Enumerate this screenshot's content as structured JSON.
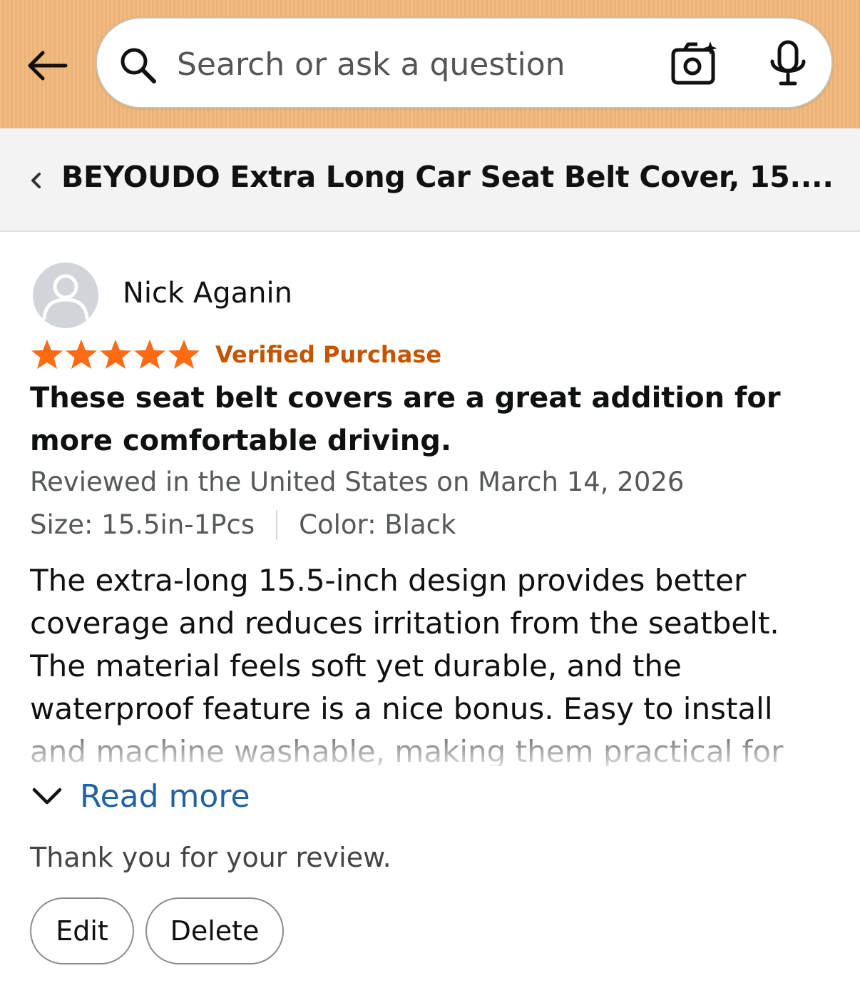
{
  "header": {
    "search": {
      "placeholder": "Search or ask a question"
    },
    "icons": {
      "back": "arrow-left-icon",
      "search": "search-icon",
      "camera": "camera-sparkle-icon",
      "mic": "microphone-icon"
    },
    "background_color": "#f0b679"
  },
  "product": {
    "title": "BEYOUDO Extra Long Car Seat Belt Cover, 15...."
  },
  "review": {
    "reviewer_name": "Nick Aganin",
    "rating": 5,
    "rating_max": 5,
    "star_color": "#ff6a13",
    "verified_label": "Verified Purchase",
    "verified_color": "#c45500",
    "title": "These seat belt covers are a great addition for more comfortable driving.",
    "date_line": "Reviewed in the United States on March 14, 2026",
    "size": "Size: 15.5in-1Pcs",
    "color": "Color: Black",
    "body": "The extra-long 15.5-inch design provides better coverage and reduces irritation from the seatbelt. The material feels soft yet durable, and the waterproof feature is a nice bonus. Easy to install and machine washable, making them practical for",
    "read_more_label": "Read more",
    "link_color": "#2162a1"
  },
  "footer": {
    "thanks": "Thank you for your review.",
    "edit_label": "Edit",
    "delete_label": "Delete"
  }
}
